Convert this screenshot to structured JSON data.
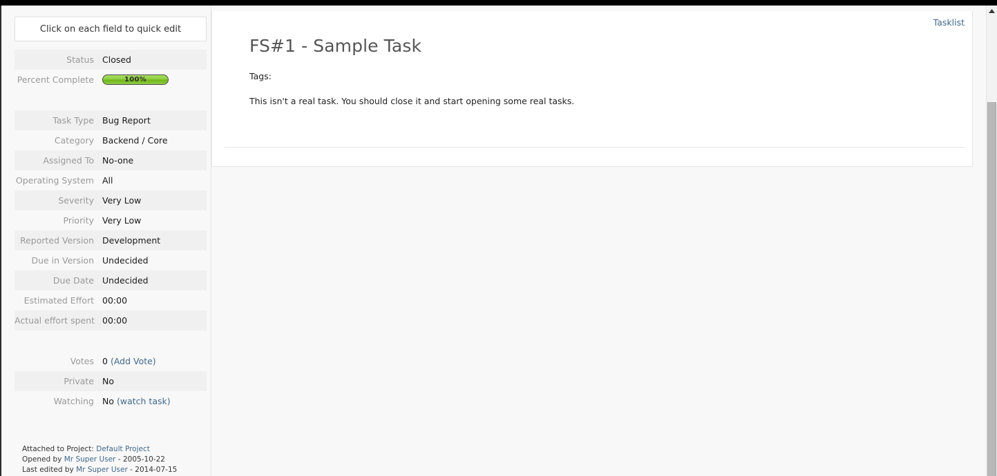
{
  "window": {
    "scrollbar": {
      "up_arrow_icon": "triangle-up-icon"
    }
  },
  "sidebar": {
    "quick_edit_hint": "Click on each field to quick edit",
    "groups": [
      {
        "fields": [
          {
            "label": "Status",
            "value": "Closed",
            "type": "text"
          },
          {
            "label": "Percent Complete",
            "value": "100%",
            "type": "progress",
            "percent": 100
          }
        ]
      },
      {
        "fields": [
          {
            "label": "Task Type",
            "value": "Bug Report",
            "type": "text"
          },
          {
            "label": "Category",
            "value": "Backend / Core",
            "type": "text"
          },
          {
            "label": "Assigned To",
            "value": "No-one",
            "type": "text"
          },
          {
            "label": "Operating System",
            "value": "All",
            "type": "text"
          },
          {
            "label": "Severity",
            "value": "Very Low",
            "type": "text"
          },
          {
            "label": "Priority",
            "value": "Very Low",
            "type": "text"
          },
          {
            "label": "Reported Version",
            "value": "Development",
            "type": "text"
          },
          {
            "label": "Due in Version",
            "value": "Undecided",
            "type": "text"
          },
          {
            "label": "Due Date",
            "value": "Undecided",
            "type": "text"
          },
          {
            "label": "Estimated Effort",
            "value": "00:00",
            "type": "text"
          },
          {
            "label": "Actual effort spent",
            "value": "00:00",
            "type": "text"
          }
        ]
      },
      {
        "fields": [
          {
            "label": "Votes",
            "value": "0",
            "type": "link",
            "link_text": "(Add Vote)"
          },
          {
            "label": "Private",
            "value": "No",
            "type": "text"
          },
          {
            "label": "Watching",
            "value": "No",
            "type": "link",
            "link_text": "(watch task)"
          }
        ]
      }
    ],
    "footer": {
      "attached_prefix": "Attached to Project:",
      "project_name": "Default Project",
      "opened_prefix": "Opened by",
      "opened_user": "Mr Super User",
      "opened_sep": "-",
      "opened_date": "2005-10-22",
      "edited_prefix": "Last edited by",
      "edited_user": "Mr Super User",
      "edited_sep": "-",
      "edited_date": "2014-07-15"
    }
  },
  "main": {
    "tasklist_label": "Tasklist",
    "title": "FS#1 - Sample Task",
    "tags_label": "Tags:",
    "description": "This isn't a real task. You should close it and start opening some real tasks."
  },
  "colors": {
    "link": "#40688c",
    "label_text": "#9a9a9a",
    "value_text": "#1a1a1a",
    "row_stripe": "#f0f0f0",
    "page_bg": "#f8f8f8",
    "panel_bg": "#ffffff",
    "progress_green": "#8ccc3c",
    "topbar": "#000000"
  }
}
